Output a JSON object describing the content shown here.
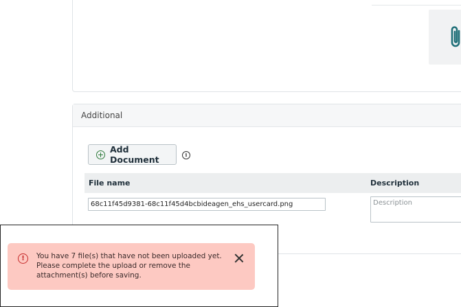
{
  "additional": {
    "title": "Additional",
    "add_document_label": "Add Document",
    "columns": {
      "file_name": "File name",
      "description": "Description"
    },
    "rows": [
      {
        "file_name": "68c11f45d9381-68c11f45d4bcbideagen_ehs_usercard.png",
        "description_placeholder": "Description"
      }
    ]
  },
  "toast": {
    "message": "You have 7 file(s) that have not been uploaded yet. Please complete the upload or remove the attachment(s) before saving.",
    "type": "error"
  },
  "colors": {
    "toast_background": "#fdc9c2",
    "error": "#c62828",
    "attachment_icon": "#1f6f78",
    "add_icon": "#2d7a3a"
  },
  "icons": {
    "attachment": "paperclip-icon",
    "add": "plus-circle-icon",
    "info": "info-icon",
    "alert": "alert-circle-icon",
    "close": "close-icon"
  }
}
